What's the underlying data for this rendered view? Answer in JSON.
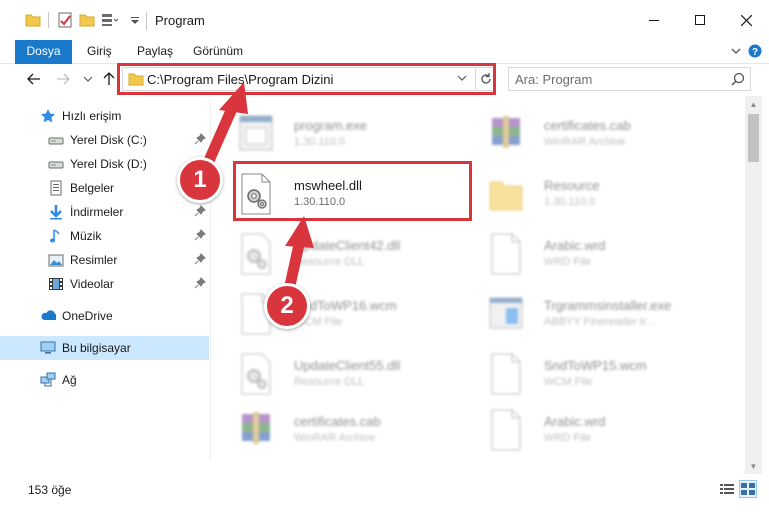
{
  "window": {
    "title": "Program"
  },
  "ribbon": {
    "tabs": [
      {
        "id": "file",
        "label": "Dosya"
      },
      {
        "id": "home",
        "label": "Giriş"
      },
      {
        "id": "share",
        "label": "Paylaş"
      },
      {
        "id": "view",
        "label": "Görünüm"
      }
    ]
  },
  "address": {
    "path": "C:\\Program Files\\Program Dizini"
  },
  "search": {
    "placeholder": "Ara: Program"
  },
  "sidebar": {
    "items": [
      {
        "label": "Hızlı erişim",
        "icon": "star-icon",
        "pinned": false
      },
      {
        "label": "Yerel Disk (C:)",
        "icon": "drive-icon",
        "pinned": true
      },
      {
        "label": "Yerel Disk (D:)",
        "icon": "drive-icon",
        "pinned": true
      },
      {
        "label": "Belgeler",
        "icon": "documents-icon",
        "pinned": true
      },
      {
        "label": "İndirmeler",
        "icon": "downloads-icon",
        "pinned": true
      },
      {
        "label": "Müzik",
        "icon": "music-icon",
        "pinned": true
      },
      {
        "label": "Resimler",
        "icon": "pictures-icon",
        "pinned": true
      },
      {
        "label": "Videolar",
        "icon": "videos-icon",
        "pinned": true
      },
      {
        "label": "OneDrive",
        "icon": "onedrive-icon",
        "pinned": false
      },
      {
        "label": "Bu bilgisayar",
        "icon": "this-pc-icon",
        "pinned": false,
        "selected": true
      },
      {
        "label": "Ağ",
        "icon": "network-icon",
        "pinned": false
      }
    ]
  },
  "files": [
    {
      "name": "program.exe",
      "sub": "1.30.110.0",
      "icon": "exe-icon"
    },
    {
      "name": "certificates.cab",
      "sub": "WinRAR Archive",
      "icon": "rar-archive-icon"
    },
    {
      "name": "mswheel.dll",
      "sub": "1.30.110.0",
      "icon": "dll-gear-icon",
      "highlight": true
    },
    {
      "name": "Resource",
      "sub": "1.30.110.0",
      "icon": "folder-icon"
    },
    {
      "name": "UpdateClient42.dll",
      "sub": "Resource DLL",
      "icon": "dll-gear-icon"
    },
    {
      "name": "Arabic.wrd",
      "sub": "WRD File",
      "icon": "blank-file-icon"
    },
    {
      "name": "SndToWP16.wcm",
      "sub": "WCM File",
      "icon": "blank-file-icon"
    },
    {
      "name": "Trgrammsinstaller.exe",
      "sub": "ABBYY Finereader tr...",
      "icon": "installer-icon"
    },
    {
      "name": "UpdateClient55.dll",
      "sub": "Resource DLL",
      "icon": "dll-gear-icon"
    },
    {
      "name": "SndToWP15.wcm",
      "sub": "WCM File",
      "icon": "blank-file-icon"
    },
    {
      "name": "certificates.cab",
      "sub": "WinRAR Archive",
      "icon": "rar-archive-icon"
    },
    {
      "name": "Arabic.wrd",
      "sub": "WRD File",
      "icon": "blank-file-icon"
    }
  ],
  "status": {
    "count": "153 öğe"
  },
  "annotations": {
    "marker1": "1",
    "marker2": "2",
    "color": "#d8353d"
  },
  "colors": {
    "accent": "#1979ca",
    "selection": "#cce8ff"
  }
}
